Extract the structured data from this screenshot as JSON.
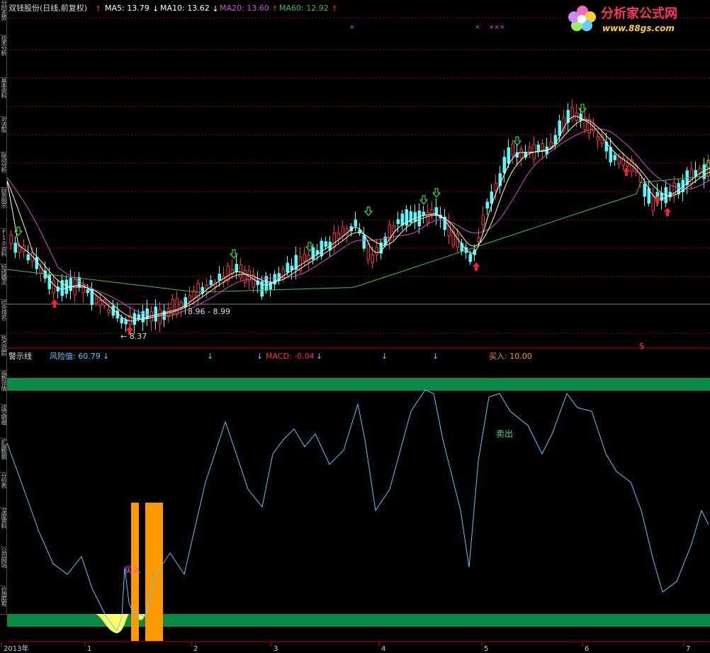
{
  "price_panel": {
    "title": "双钱股份(日线,前复权)",
    "indicators": [
      {
        "label": "MA5: 13.79",
        "arrow": "↓",
        "color": "#ffffff",
        "arrow_color": "#ffffff"
      },
      {
        "label": "MA10: 13.62",
        "arrow": "↓",
        "color": "#ffffff",
        "arrow_color": "#ffffff"
      },
      {
        "label": "MA20: 13.60",
        "arrow": "↑",
        "color": "#d050d0",
        "arrow_color": "#ff3030"
      },
      {
        "label": "MA60: 12.92",
        "arrow": "↑",
        "color": "#40c040",
        "arrow_color": "#ff3030"
      }
    ],
    "low_label": "8.37",
    "range_label": "8.96 - 8.99",
    "dollar_mark": "$",
    "x_marks": [
      "×",
      "×",
      "×××"
    ]
  },
  "signal_panel": {
    "title": "警示线",
    "risk_label": "风险值: 60.79",
    "macd_label": "MACD: -0.04",
    "buy_header": "买入: 10.00",
    "buy_text": "买入",
    "sell_text": "卖出",
    "arrow_down": "↓"
  },
  "side_tabs": [
    "分时走势",
    "技术分析",
    "基本资料",
    "可选股",
    "联动分析",
    "财务图示",
    "F10资料",
    "短线精灵",
    "综合排名",
    "热点追踪",
    "指数详情",
    "成交明细",
    "扩展数据",
    "分价表",
    "深度资料",
    "公司网站",
    "价值股有"
  ],
  "date_axis": [
    "2013年",
    "1",
    "2",
    "3",
    "4",
    "5",
    "6",
    "7"
  ],
  "logo": {
    "title": "分析家公式网",
    "url": "www.88gs.com"
  },
  "colors": {
    "up": "#ff3232",
    "down": "#54fcfc",
    "ma5": "#ffffff",
    "ma10": "#ffffa0",
    "ma20": "#d050d0",
    "ma60": "#40c040",
    "signal": "#54c8ff",
    "band": "#0a8a44",
    "bar": "#ff9900"
  }
}
